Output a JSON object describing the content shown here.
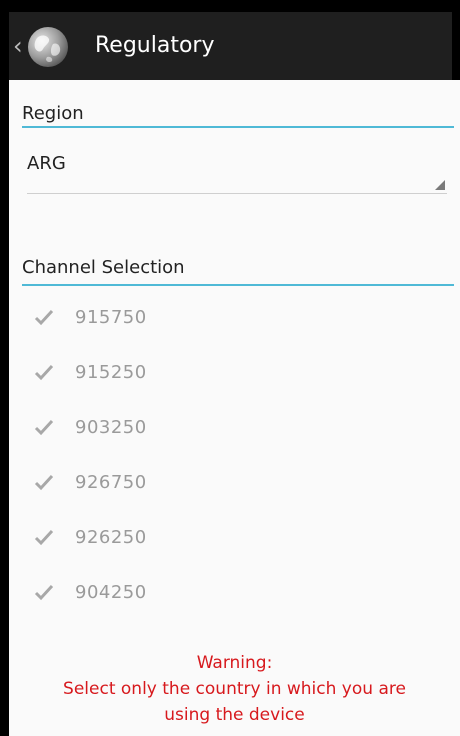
{
  "actionbar": {
    "back_glyph": "‹",
    "title": "Regulatory",
    "icon": "globe-icon"
  },
  "region": {
    "header": "Region",
    "selected_value": "ARG"
  },
  "channels": {
    "header": "Channel Selection",
    "items": [
      {
        "label": "915750",
        "checked": true
      },
      {
        "label": "915250",
        "checked": true
      },
      {
        "label": "903250",
        "checked": true
      },
      {
        "label": "926750",
        "checked": true
      },
      {
        "label": "926250",
        "checked": true
      },
      {
        "label": "904250",
        "checked": true
      }
    ]
  },
  "warning": {
    "line1": "Warning:",
    "line2": "Select only the country in which you are",
    "line3": "using the device"
  },
  "colors": {
    "accent": "#4fb9d6",
    "warning": "#d7191d",
    "actionbar": "#1f1f1f"
  }
}
